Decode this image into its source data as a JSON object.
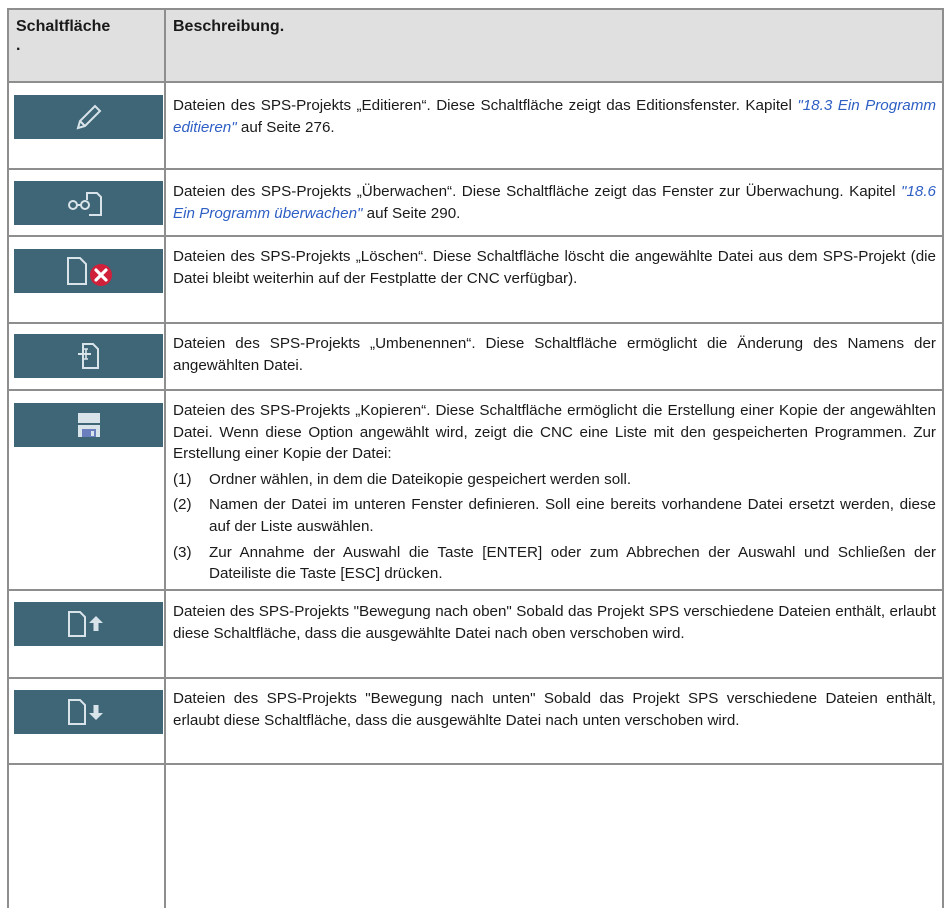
{
  "header": {
    "col1": "Schaltfläche",
    "col1_dot": ".",
    "col2": "Beschreibung."
  },
  "rows": [
    {
      "icon": "pencil-icon",
      "text_a": "Dateien des SPS-Projekts „Editieren“. Diese Schaltfläche zeigt das Editionsfenster. Kapitel ",
      "link": "\"18.3 Ein Programm editieren\"",
      "text_b": " auf Seite 276."
    },
    {
      "icon": "monitor-icon",
      "text_a": "Dateien des SPS-Projekts „Überwachen“. Diese Schaltfläche zeigt das Fenster zur Überwachung. Kapitel ",
      "link": "\"18.6 Ein Programm überwachen\"",
      "text_b": " auf Seite 290."
    },
    {
      "icon": "delete-file-icon",
      "text": "Dateien des SPS-Projekts „Löschen“. Diese Schaltfläche löscht die angewählte Datei aus dem SPS-Projekt (die Datei bleibt weiterhin auf der Festplatte der CNC verfügbar)."
    },
    {
      "icon": "rename-file-icon",
      "text": "Dateien des SPS-Projekts „Umbenennen“. Diese Schaltfläche ermöglicht die Änderung des Namens der angewählten Datei."
    },
    {
      "icon": "save-disk-icon",
      "text": "Dateien des SPS-Projekts „Kopieren“. Diese Schaltfläche ermöglicht die Erstellung einer Kopie der angewählten Datei. Wenn diese Option angewählt wird, zeigt die CNC eine Liste mit den gespeicherten Programmen. Zur Erstellung einer Kopie der Datei:",
      "steps": [
        {
          "num": "(1)",
          "text": "Ordner wählen, in dem die Dateikopie gespeichert werden soll."
        },
        {
          "num": "(2)",
          "text": "Namen der Datei im unteren Fenster definieren. Soll eine bereits vorhandene Datei ersetzt werden, diese auf der Liste auswählen."
        },
        {
          "num": "(3)",
          "text": "Zur Annahme der Auswahl die Taste [ENTER] oder zum Abbrechen der Auswahl und Schließen der Dateiliste die Taste [ESC] drücken."
        }
      ]
    },
    {
      "icon": "move-up-icon",
      "text": "Dateien des SPS-Projekts \"Bewegung nach oben\" Sobald das Projekt SPS verschiedene Dateien enthält, erlaubt diese Schaltfläche, dass die ausgewählte Datei nach oben verschoben wird."
    },
    {
      "icon": "move-down-icon",
      "text": "Dateien des SPS-Projekts \"Bewegung nach unten\" Sobald das Projekt SPS verschiedene Dateien enthält, erlaubt diese Schaltfläche, dass die ausgewählte Datei nach unten verschoben wird."
    }
  ],
  "colors": {
    "button_bg": "#3f6677",
    "icon_fg": "#d9e4ea",
    "delete_red": "#d0203a",
    "link": "#2e5fc4",
    "header_bg": "#e0e0e0"
  }
}
